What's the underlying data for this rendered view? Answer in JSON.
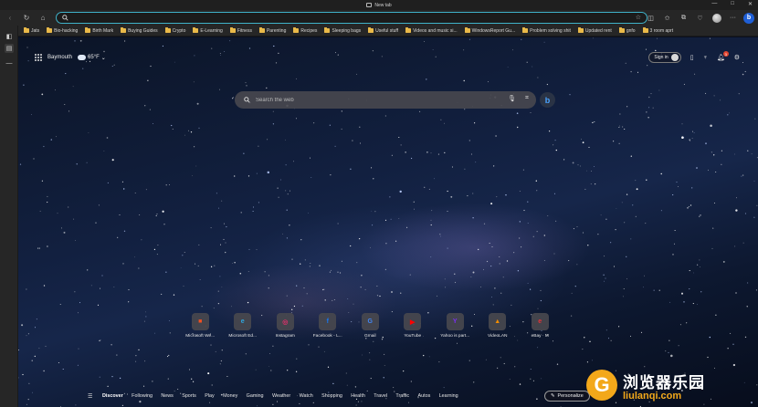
{
  "window": {
    "title": "New tab",
    "controls": {
      "minimize": "—",
      "maximize": "□",
      "close": "✕"
    }
  },
  "toolbar": {
    "address_value": "",
    "address_placeholder": ""
  },
  "bookmarks": [
    "Jats",
    "Bio-hacking",
    "Birth Mark",
    "Buying Guides",
    "Crypto",
    "E-Learning",
    "Fitness",
    "Parenting",
    "Recipes",
    "Sleeping bags",
    "Useful stuff",
    "Videos and music si...",
    "WindowsReport Gu...",
    "Problem solving shit",
    "Updated rent",
    "gnfo",
    "3 room aprt"
  ],
  "header": {
    "location": "Baymouth",
    "temperature": "65°F",
    "signin_label": "Sign in",
    "notification_count": "3"
  },
  "search": {
    "placeholder": "Search the web"
  },
  "quick_links": [
    {
      "label": "Microsoft We...",
      "icon": "microsoft-icon",
      "glyph": "■",
      "color": "#f25022"
    },
    {
      "label": "Microsoft Ed...",
      "icon": "edge-icon",
      "glyph": "e",
      "color": "#2fa8e0"
    },
    {
      "label": "Instagram",
      "icon": "instagram-icon",
      "glyph": "◎",
      "color": "#e1306c"
    },
    {
      "label": "Facebook - L...",
      "icon": "facebook-icon",
      "glyph": "f",
      "color": "#1877f2"
    },
    {
      "label": "Gmail",
      "icon": "google-icon",
      "glyph": "G",
      "color": "#4285f4"
    },
    {
      "label": "YouTube",
      "icon": "youtube-icon",
      "glyph": "▶",
      "color": "#ff0000"
    },
    {
      "label": "Yahoo is part...",
      "icon": "yahoo-icon",
      "glyph": "Y",
      "color": "#7b2ff2"
    },
    {
      "label": "VideoLAN",
      "icon": "vlc-icon",
      "glyph": "▲",
      "color": "#f28c00"
    },
    {
      "label": "eBay · M",
      "icon": "ebay-icon",
      "glyph": "e",
      "color": "#e53238"
    }
  ],
  "feed_tabs": [
    "Discover",
    "Following",
    "News",
    "Sports",
    "Play",
    "Money",
    "Gaming",
    "Weather",
    "Watch",
    "Shopping",
    "Health",
    "Travel",
    "Traffic",
    "Autos",
    "Learning"
  ],
  "personalize_label": "Personalize",
  "watermark": {
    "logo": "G",
    "cn": "浏览器乐园",
    "url": "liulanqi.com"
  }
}
